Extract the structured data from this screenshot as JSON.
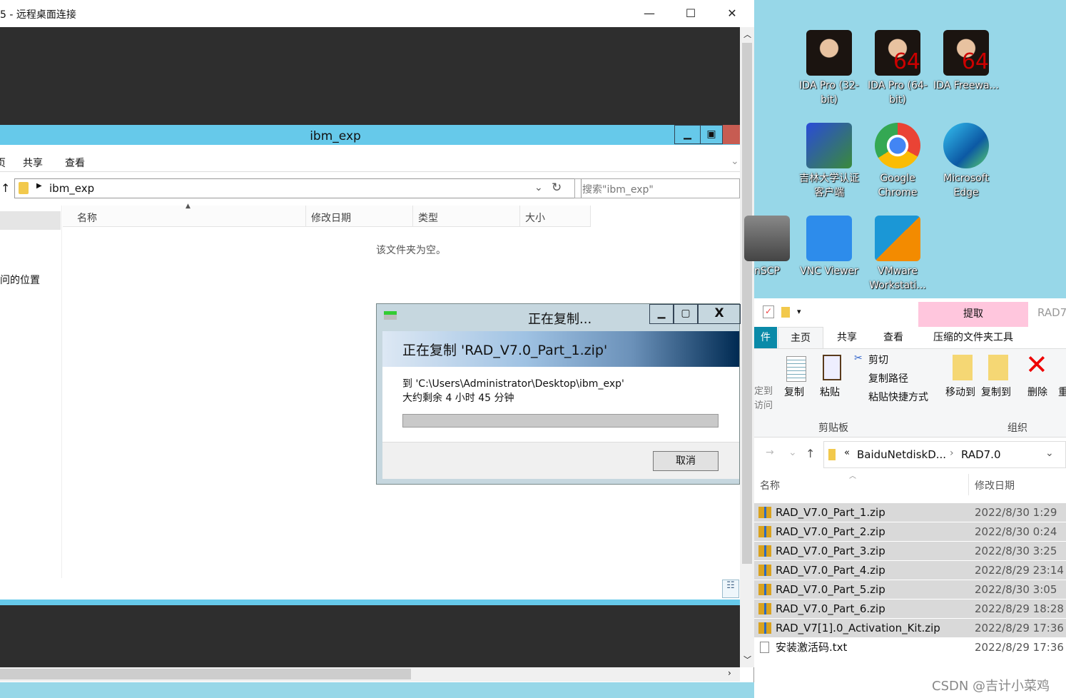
{
  "rdp": {
    "title": "5 - 远程桌面连接",
    "minimize": "—",
    "maximize": "☐",
    "close": "✕"
  },
  "explorer": {
    "title": "ibm_exp",
    "ribbon_tabs": [
      "页",
      "共享",
      "查看"
    ],
    "path": "ibm_exp",
    "search_placeholder": "搜索\"ibm_exp\"",
    "columns": [
      "名称",
      "修改日期",
      "类型",
      "大小"
    ],
    "empty_text": "该文件夹为空。",
    "left_item": "问的位置"
  },
  "copy_dialog": {
    "title": "正在复制...",
    "heading": "正在复制 'RAD_V7.0_Part_1.zip'",
    "destination": "到 'C:\\Users\\Administrator\\Desktop\\ibm_exp'",
    "time_remaining": "大约剩余 4 小时 45 分钟",
    "progress_percent": 0,
    "cancel": "取消"
  },
  "desktop_icons": [
    {
      "label": "IDA Pro (32-bit)",
      "icon": "ida-icon"
    },
    {
      "label": "IDA Pro (64-bit)",
      "icon": "ida64-icon"
    },
    {
      "label": "IDA Freewa...",
      "icon": "ida64-icon"
    },
    {
      "label": "吉林大学认证客户端",
      "icon": "network-icon"
    },
    {
      "label": "Google Chrome",
      "icon": "chrome-icon"
    },
    {
      "label": "Microsoft Edge",
      "icon": "edge-icon"
    },
    {
      "label": "nSCP",
      "icon": "winscp-icon"
    },
    {
      "label": "VNC Viewer",
      "icon": "vnc-icon"
    },
    {
      "label": "VMware Workstati...",
      "icon": "vmware-icon"
    }
  ],
  "right_explorer": {
    "extract_tab": "提取",
    "title_partial": "RAD7",
    "tabs": [
      "件",
      "主页",
      "共享",
      "查看",
      "压缩的文件夹工具"
    ],
    "ribbon": {
      "pin": "定到\n访问",
      "copy": "复制",
      "paste": "粘贴",
      "cut": "剪切",
      "copy_path": "复制路径",
      "paste_shortcut": "粘贴快捷方式",
      "clipboard_group": "剪贴板",
      "move_to": "移动到",
      "copy_to": "复制到",
      "delete": "删除",
      "rename": "重",
      "organize_group": "组织"
    },
    "breadcrumb": [
      "BaiduNetdiskD...",
      "RAD7.0"
    ],
    "columns": [
      "名称",
      "修改日期"
    ],
    "files": [
      {
        "name": "RAD_V7.0_Part_1.zip",
        "date": "2022/8/30 1:29",
        "selected": true
      },
      {
        "name": "RAD_V7.0_Part_2.zip",
        "date": "2022/8/30 0:24",
        "selected": true
      },
      {
        "name": "RAD_V7.0_Part_3.zip",
        "date": "2022/8/30 3:25",
        "selected": true
      },
      {
        "name": "RAD_V7.0_Part_4.zip",
        "date": "2022/8/29 23:14",
        "selected": true
      },
      {
        "name": "RAD_V7.0_Part_5.zip",
        "date": "2022/8/30 3:05",
        "selected": true
      },
      {
        "name": "RAD_V7.0_Part_6.zip",
        "date": "2022/8/29 18:28",
        "selected": true
      },
      {
        "name": "RAD_V7[1].0_Activation_Kit.zip",
        "date": "2022/8/29 17:36",
        "selected": true
      },
      {
        "name": "安装激活码.txt",
        "date": "2022/8/29 17:36",
        "selected": false
      }
    ]
  },
  "watermark": "CSDN @吉计小菜鸡"
}
